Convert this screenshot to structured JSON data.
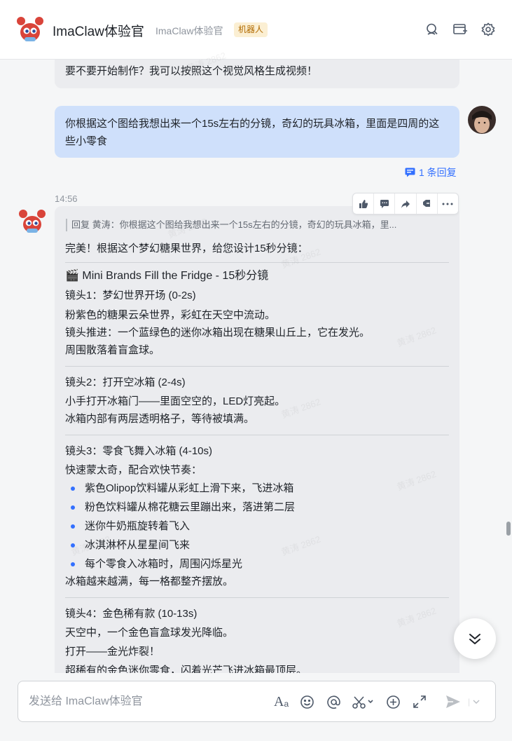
{
  "header": {
    "title": "ImaClaw体验官",
    "subtitle": "ImaClaw体验官",
    "badge": "机器人"
  },
  "messages": {
    "prev_bot_text": "要不要开始制作？我可以按照这个视觉风格生成视频！",
    "user_text": "你根据这个图给我想出来一个15s左右的分镜，奇幻的玩具冰箱，里面是四周的这些小零食",
    "reply_count": "1 条回复",
    "timestamp": "14:56",
    "quote": "回复 黄涛：你根据这个图给我想出来一个15s左右的分镜，奇幻的玩具冰箱，里...",
    "intro": "完美！根据这个梦幻糖果世界，给您设计15秒分镜：",
    "heading": "🎬 Mini Brands Fill the Fridge - 15秒分镜",
    "shot1": {
      "title": "镜头1：梦幻世界开场 (0-2s)",
      "lines": [
        "粉紫色的糖果云朵世界，彩虹在天空中流动。",
        "镜头推进：一个蓝绿色的迷你冰箱出现在糖果山丘上，它在发光。",
        "周围散落着盲盒球。"
      ]
    },
    "shot2": {
      "title": "镜头2：打开空冰箱 (2-4s)",
      "lines": [
        "小手打开冰箱门——里面空空的，LED灯亮起。",
        "冰箱内部有两层透明格子，等待被填满。"
      ]
    },
    "shot3": {
      "title": "镜头3：零食飞舞入冰箱 (4-10s)",
      "intro": "快速蒙太奇，配合欢快节奏：",
      "bullets": [
        "紫色Olipop饮料罐从彩虹上滑下来，飞进冰箱",
        "粉色饮料罐从棉花糖云里蹦出来，落进第二层",
        "迷你牛奶瓶旋转着飞入",
        "冰淇淋杯从星星间飞来",
        "每个零食入冰箱时，周围闪烁星光"
      ],
      "outro": "冰箱越来越满，每一格都整齐摆放。"
    },
    "shot4": {
      "title": "镜头4：金色稀有款 (10-13s)",
      "lines": [
        "天空中，一个金色盲盒球发光降临。",
        "打开——金光炸裂！",
        "超稀有的金色迷你零食，闪着光芒飞进冰箱最顶层。"
      ]
    }
  },
  "input": {
    "placeholder": "发送给 ImaClaw体验官"
  },
  "watermark": "黄涛 2862",
  "colors": {
    "accent": "#3370ff",
    "user_bubble": "#cfe0fb",
    "bot_bubble": "#ebecef",
    "badge_bg": "#fbefd3",
    "badge_text": "#b26b00"
  },
  "icons": [
    "search-icon",
    "new-window-icon",
    "settings-icon",
    "thumbs-up-icon",
    "comment-icon",
    "forward-icon",
    "pin-icon",
    "more-icon",
    "reply-icon",
    "font-icon",
    "emoji-icon",
    "mention-icon",
    "scissors-icon",
    "add-icon",
    "expand-icon",
    "send-icon",
    "scroll-down-icon"
  ]
}
